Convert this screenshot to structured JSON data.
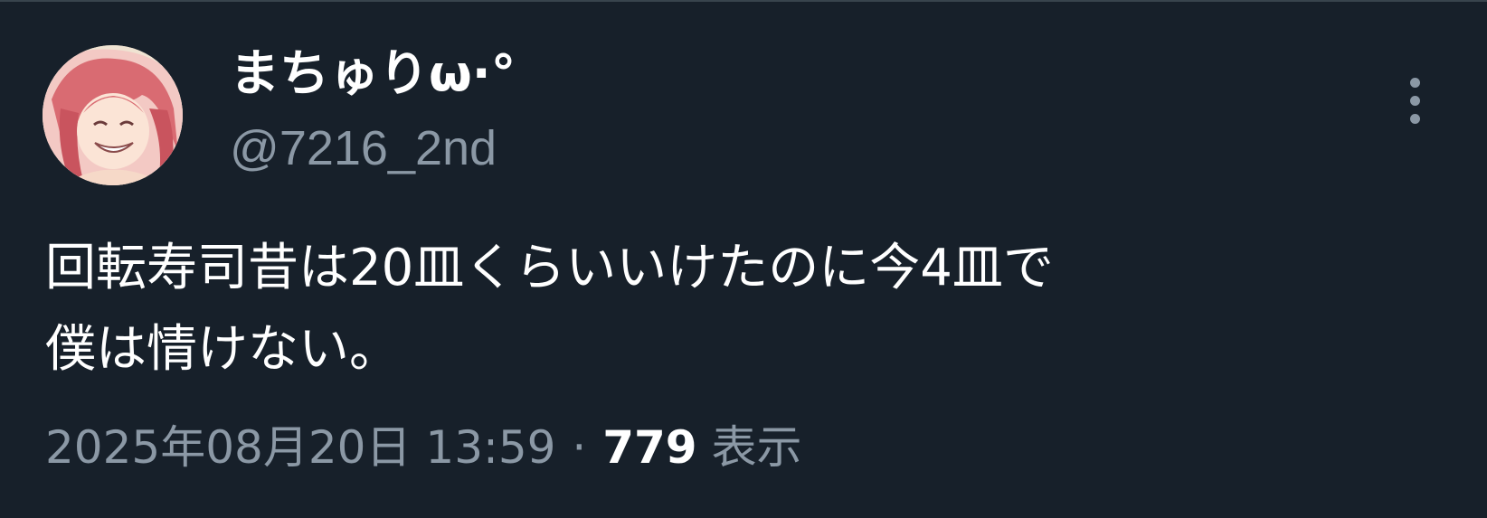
{
  "tweet": {
    "author": {
      "display_name": "まちゅりω·°",
      "handle": "@7216_2nd",
      "avatar_icon": "avatar-anime-girl-pink-hair"
    },
    "more_icon": "more-vertical-icon",
    "text": "回転寿司昔は20皿くらいいけたのに今4皿で\n僕は情けない。",
    "timestamp": "2025年08月20日 13:59",
    "separator": "·",
    "views_count": "779",
    "views_label": "表示"
  },
  "colors": {
    "background": "#17202a",
    "primary_text": "#ffffff",
    "secondary_text": "#8b98a5",
    "divider": "#38444d"
  }
}
